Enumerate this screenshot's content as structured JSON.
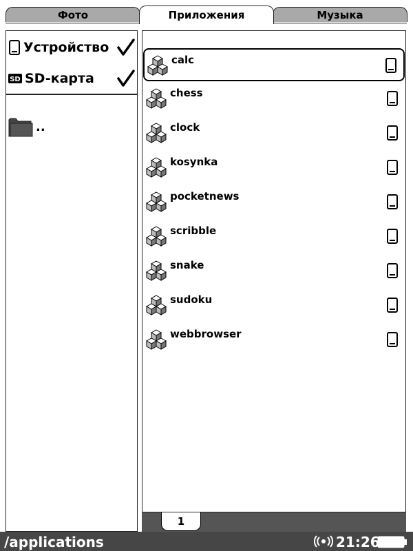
{
  "tabs": [
    {
      "label": "Фото",
      "active": false
    },
    {
      "label": "Приложения",
      "active": true
    },
    {
      "label": "Музыка",
      "active": false
    }
  ],
  "storage": [
    {
      "label": "Устройство",
      "icon": "device-icon",
      "checked": true
    },
    {
      "label": "SD-карта",
      "icon": "sd-card-icon",
      "checked": true
    }
  ],
  "folder": {
    "label": "..",
    "icon": "folder-icon"
  },
  "apps": [
    {
      "name": "calc",
      "selected": true
    },
    {
      "name": "chess"
    },
    {
      "name": "clock"
    },
    {
      "name": "kosynka"
    },
    {
      "name": "pocketnews"
    },
    {
      "name": "scribble"
    },
    {
      "name": "snake"
    },
    {
      "name": "sudoku"
    },
    {
      "name": "webbrowser"
    }
  ],
  "pager": {
    "current_page": "1"
  },
  "status": {
    "path": "/applications",
    "time": "21:26",
    "wifi_icon": "wifi-icon",
    "battery_icon": "battery-icon"
  }
}
